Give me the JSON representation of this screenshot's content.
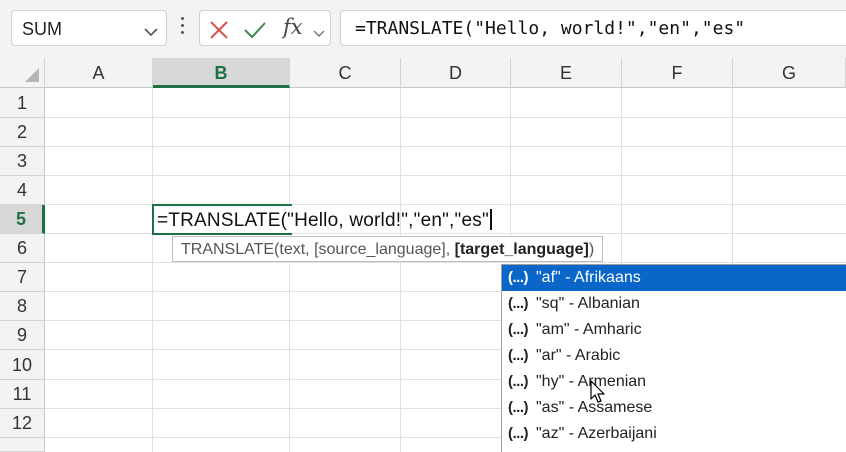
{
  "name_box": {
    "value": "SUM"
  },
  "formula_bar": {
    "fx_label": "fx",
    "formula": "=TRANSLATE(\"Hello, world!\",\"en\",\"es\""
  },
  "grid": {
    "columns": [
      "A",
      "B",
      "C",
      "D",
      "E",
      "F",
      "G"
    ],
    "rows": [
      "1",
      "2",
      "3",
      "4",
      "5",
      "6",
      "7",
      "8",
      "9",
      "10",
      "11",
      "12"
    ],
    "selected_column": "B",
    "selected_row": "5"
  },
  "active_cell": {
    "edit_text": "=TRANSLATE(\"Hello, world!\",\"en\",\"es\""
  },
  "tooltip": {
    "prefix": "TRANSLATE(text, [source_language], ",
    "current_arg": "[target_language]",
    "suffix": ")"
  },
  "autocomplete": {
    "icon": "(...)",
    "items": [
      {
        "label": "\"af\" - Afrikaans",
        "selected": true
      },
      {
        "label": "\"sq\" - Albanian",
        "selected": false
      },
      {
        "label": "\"am\" - Amharic",
        "selected": false
      },
      {
        "label": "\"ar\" - Arabic",
        "selected": false
      },
      {
        "label": "\"hy\" - Armenian",
        "selected": false
      },
      {
        "label": "\"as\" - Assamese",
        "selected": false
      },
      {
        "label": "\"az\" - Azerbaijani",
        "selected": false
      }
    ]
  },
  "colors": {
    "accent_green": "#1e7145",
    "selection_blue": "#0a66c8",
    "cancel_red": "#d9534f",
    "confirm_green": "#3a8a4a"
  }
}
